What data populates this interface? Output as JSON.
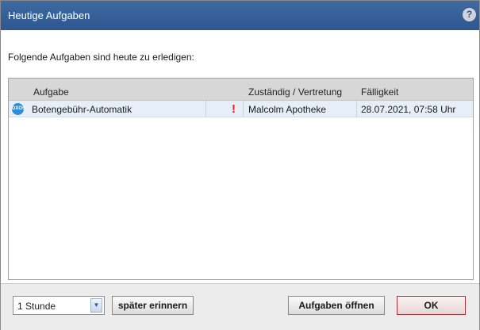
{
  "window": {
    "title": "Heutige Aufgaben",
    "help_label": "?"
  },
  "intro_text": "Folgende Aufgaben sind heute zu erledigen:",
  "table": {
    "headers": {
      "task": "Aufgabe",
      "responsible": "Zuständig / Vertretung",
      "due": "Fälligkeit"
    },
    "rows": [
      {
        "icon": "dxos-logo-icon",
        "icon_text": "DXOS",
        "task": "Botengebühr-Automatik",
        "priority_icon": "exclamation-priority-icon",
        "priority_symbol": "!",
        "responsible": "Malcolm Apotheke",
        "due": "28.07.2021, 07:58 Uhr"
      }
    ]
  },
  "footer": {
    "reminder_select": {
      "selected": "1 Stunde",
      "arrow": "▼"
    },
    "later_button": "später erinnern",
    "open_button": "Aufgaben öffnen",
    "ok_button": "OK"
  },
  "colors": {
    "titlebar": "#2e5690",
    "selected_row": "#e6eff8",
    "priority": "#e0201b"
  }
}
